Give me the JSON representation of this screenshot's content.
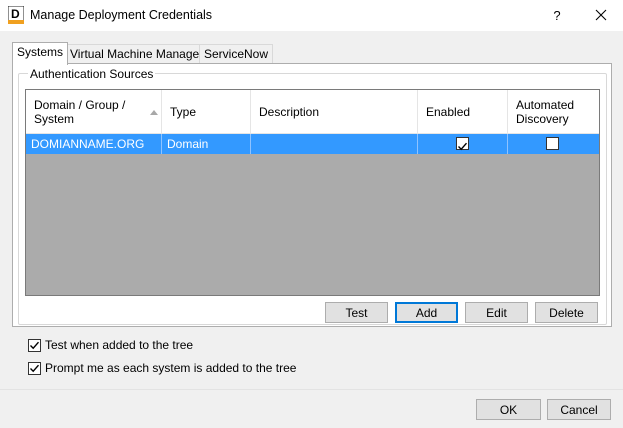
{
  "window": {
    "title": "Manage Deployment Credentials",
    "icon_letter": "D",
    "help_label": "?"
  },
  "tabs": [
    {
      "label": "Systems",
      "active": true
    },
    {
      "label": "Virtual Machine Managers",
      "active": false
    },
    {
      "label": "ServiceNow",
      "active": false
    }
  ],
  "group": {
    "legend": "Authentication Sources"
  },
  "grid": {
    "columns": [
      {
        "line1": "Domain / Group /",
        "line2": "System"
      },
      {
        "line1": "Type",
        "line2": ""
      },
      {
        "line1": "Description",
        "line2": ""
      },
      {
        "line1": "Enabled",
        "line2": ""
      },
      {
        "line1": "Automated",
        "line2": "Discovery"
      }
    ],
    "rows": [
      {
        "domain": "DOMIANNAME.ORG",
        "type": "Domain",
        "description": "",
        "enabled": true,
        "automated_discovery": false
      }
    ],
    "selected_row_color": "#3399ff"
  },
  "buttons": {
    "test": "Test",
    "add": "Add",
    "edit": "Edit",
    "delete": "Delete",
    "ok": "OK",
    "cancel": "Cancel"
  },
  "options": {
    "test_when_added": {
      "label": "Test when added to the tree",
      "checked": true
    },
    "prompt_each": {
      "label": "Prompt me as each system is added to the tree",
      "checked": true
    }
  }
}
